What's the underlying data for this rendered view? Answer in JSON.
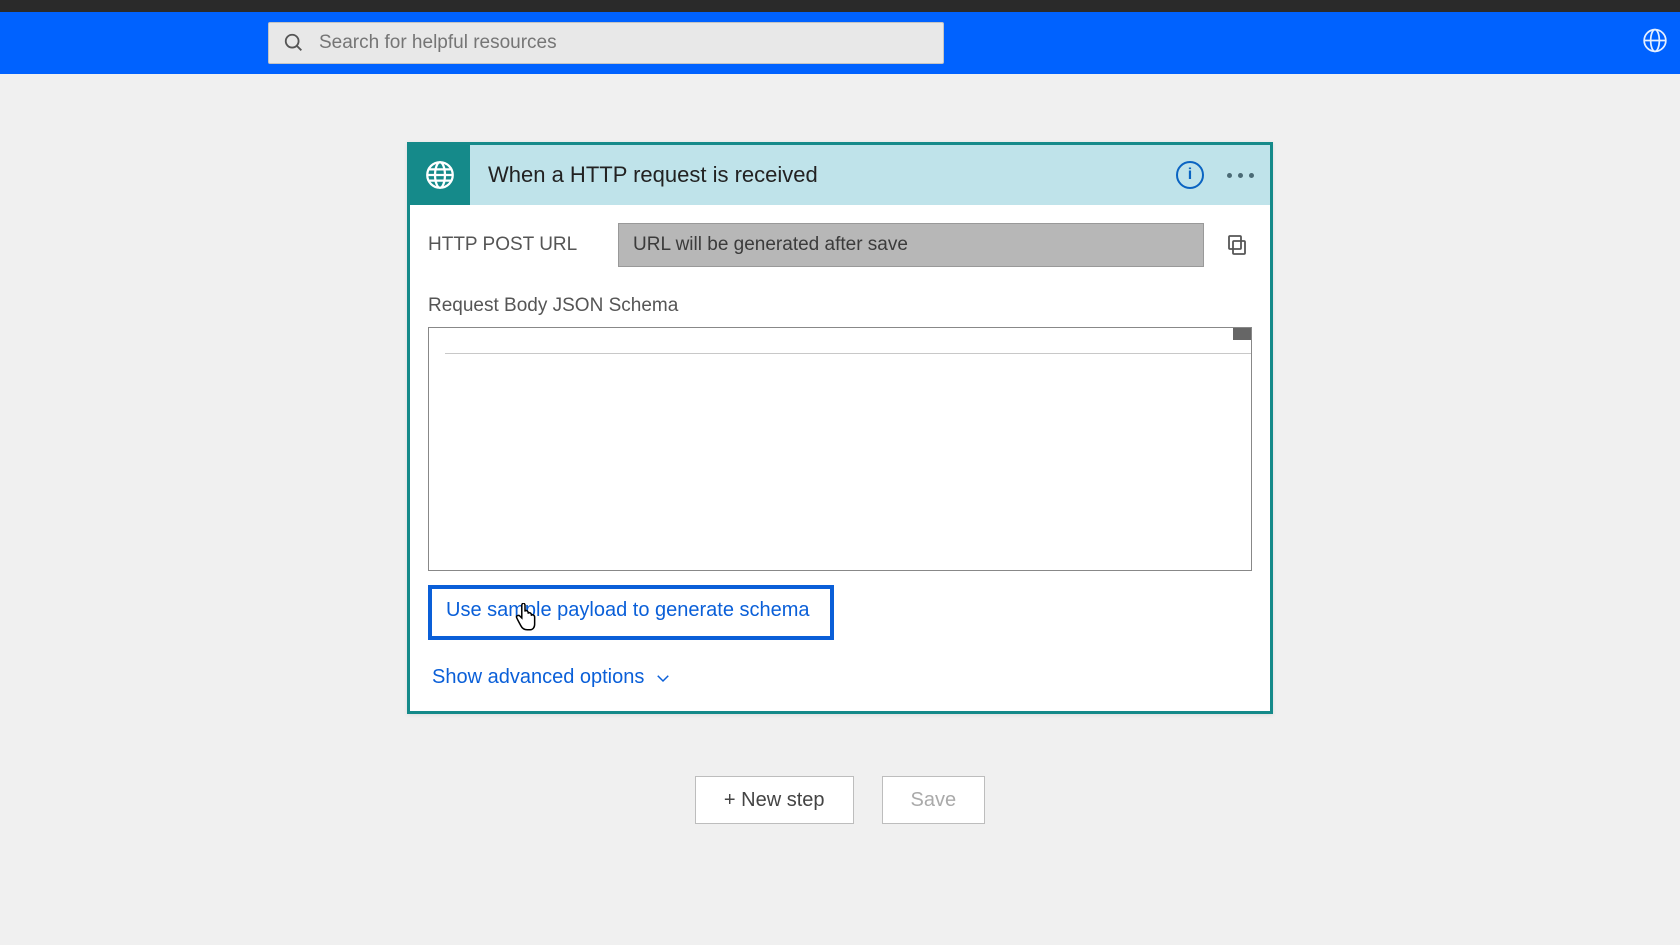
{
  "header": {
    "search_placeholder": "Search for helpful resources"
  },
  "trigger": {
    "title": "When a HTTP request is received",
    "url_label": "HTTP POST URL",
    "url_value": "URL will be generated after save",
    "schema_label": "Request Body JSON Schema",
    "sample_link": "Use sample payload to generate schema",
    "advanced_link": "Show advanced options"
  },
  "actions": {
    "new_step": "+ New step",
    "save": "Save"
  }
}
